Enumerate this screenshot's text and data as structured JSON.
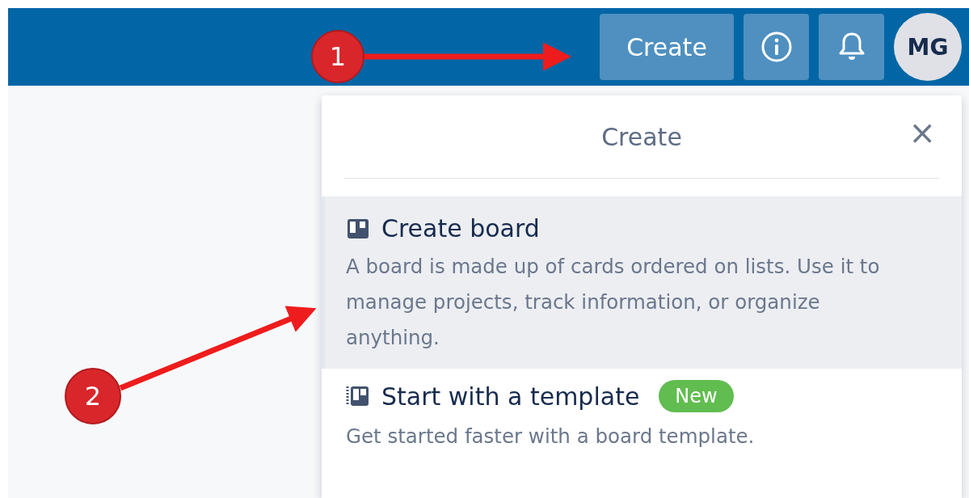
{
  "header": {
    "create_button": "Create",
    "avatar": "MG"
  },
  "popover": {
    "title": "Create",
    "close": "×",
    "items": [
      {
        "kind": "board",
        "title": "Create board",
        "description": "A board is made up of cards ordered on lists. Use it to manage projects, track information, or organize anything.",
        "selected": true
      },
      {
        "kind": "template",
        "title": "Start with a template",
        "badge": "New",
        "description": "Get started faster with a board template.",
        "selected": false
      }
    ]
  },
  "annotations": [
    {
      "number": "1"
    },
    {
      "number": "2"
    }
  ]
}
